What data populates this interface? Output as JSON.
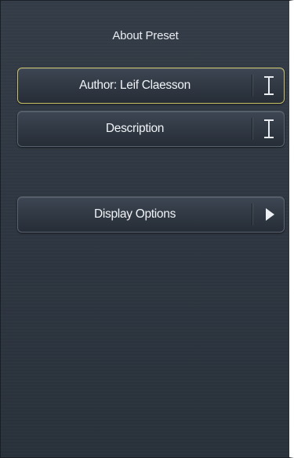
{
  "header": {
    "title": "About Preset"
  },
  "buttons": {
    "author": {
      "label": "Author: Leif Claesson",
      "icon": "text-cursor-icon"
    },
    "description": {
      "label": "Description",
      "icon": "text-cursor-icon"
    },
    "display_options": {
      "label": "Display Options",
      "icon": "play-arrow-icon"
    }
  },
  "colors": {
    "background": "#2e3641",
    "button_border": "#596270",
    "selected_border": "#c9c06a",
    "text": "#f1f4f7"
  }
}
